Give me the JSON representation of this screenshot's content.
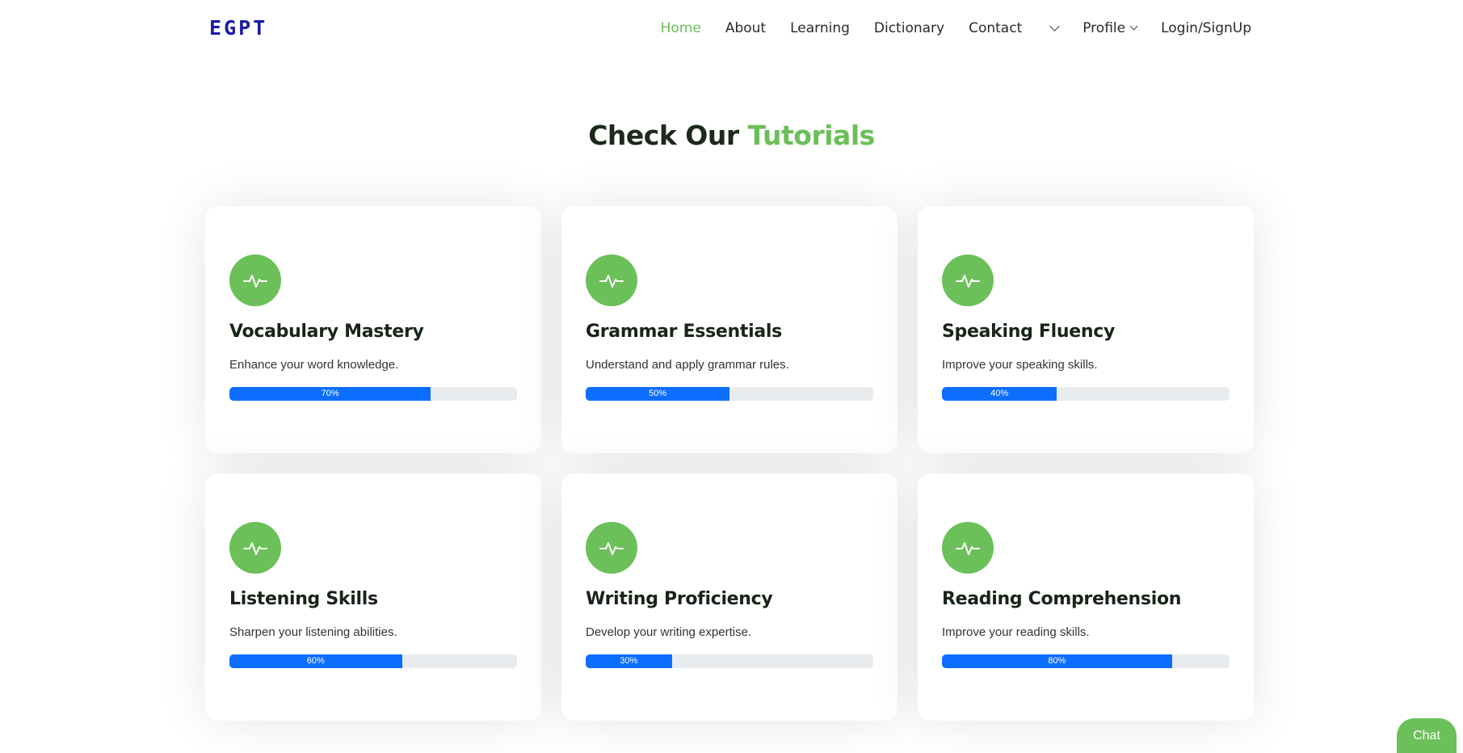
{
  "header": {
    "logo": [
      "E",
      "G",
      "P",
      "T"
    ],
    "nav": [
      {
        "label": "Home",
        "active": true
      },
      {
        "label": "About"
      },
      {
        "label": "Learning"
      },
      {
        "label": "Dictionary"
      },
      {
        "label": "Contact"
      }
    ],
    "profile_label": "Profile",
    "login_label": "Login/SignUp"
  },
  "section": {
    "title_main": "Check Our",
    "title_accent": "Tutorials"
  },
  "cards": [
    {
      "title": "Vocabulary Mastery",
      "desc": "Enhance your word knowledge.",
      "progress": 70,
      "progress_label": "70%"
    },
    {
      "title": "Grammar Essentials",
      "desc": "Understand and apply grammar rules.",
      "progress": 50,
      "progress_label": "50%"
    },
    {
      "title": "Speaking Fluency",
      "desc": "Improve your speaking skills.",
      "progress": 40,
      "progress_label": "40%"
    },
    {
      "title": "Listening Skills",
      "desc": "Sharpen your listening abilities.",
      "progress": 60,
      "progress_label": "60%"
    },
    {
      "title": "Writing Proficiency",
      "desc": "Develop your writing expertise.",
      "progress": 30,
      "progress_label": "30%"
    },
    {
      "title": "Reading Comprehension",
      "desc": "Improve your reading skills.",
      "progress": 80,
      "progress_label": "80%"
    }
  ],
  "chat": {
    "label": "Chat"
  },
  "colors": {
    "accent": "#6cc05a",
    "progress": "#0d6efd",
    "logo": "#1a1aa8"
  },
  "icons": {
    "card_icon": "activity-pulse-icon"
  }
}
